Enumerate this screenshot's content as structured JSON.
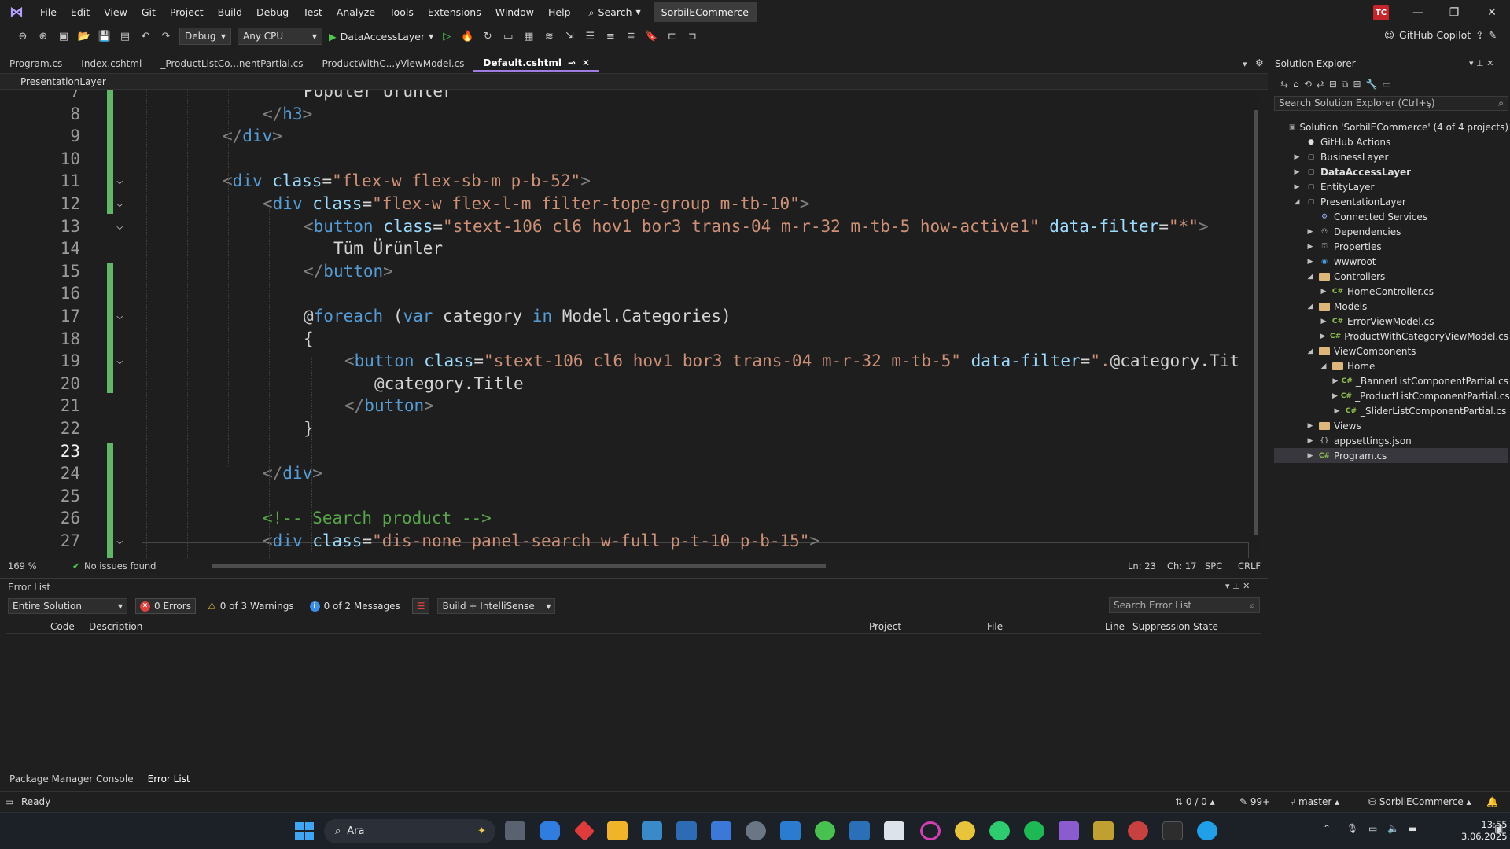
{
  "menu": {
    "items": [
      "File",
      "Edit",
      "View",
      "Git",
      "Project",
      "Build",
      "Debug",
      "Test",
      "Analyze",
      "Tools",
      "Extensions",
      "Window",
      "Help"
    ],
    "search_label": "Search",
    "solution_name": "SorbilECommerce",
    "user_initials": "TC"
  },
  "toolbar": {
    "config": "Debug",
    "platform": "Any CPU",
    "startup_project": "DataAccessLayer",
    "copilot_label": "GitHub Copilot"
  },
  "tabs": [
    {
      "label": "Program.cs",
      "active": false
    },
    {
      "label": "Index.cshtml",
      "active": false
    },
    {
      "label": "_ProductListCo...nentPartial.cs",
      "active": false
    },
    {
      "label": "ProductWithC...yViewModel.cs",
      "active": false
    },
    {
      "label": "Default.cshtml",
      "active": true
    }
  ],
  "navbar": {
    "project": "PresentationLayer"
  },
  "editor": {
    "current_line": "23",
    "lines": [
      {
        "n": "7",
        "parts": [
          [
            "tx",
            "Popüler Ürünler"
          ]
        ]
      },
      {
        "n": "8",
        "parts": [
          [
            "tag",
            "</"
          ],
          [
            "tn",
            "h3"
          ],
          [
            "tag",
            ">"
          ]
        ]
      },
      {
        "n": "9",
        "parts": [
          [
            "tag",
            "</"
          ],
          [
            "tn",
            "div"
          ],
          [
            "tag",
            ">"
          ]
        ]
      },
      {
        "n": "10",
        "parts": []
      },
      {
        "n": "11",
        "parts": [
          [
            "tag",
            "<"
          ],
          [
            "tn",
            "div "
          ],
          [
            "at",
            "class"
          ],
          [
            "tx",
            "="
          ],
          [
            "str",
            "\"flex-w flex-sb-m p-b-52\""
          ],
          [
            "tag",
            ">"
          ]
        ]
      },
      {
        "n": "12",
        "parts": [
          [
            "tag",
            "<"
          ],
          [
            "tn",
            "div "
          ],
          [
            "at",
            "class"
          ],
          [
            "tx",
            "="
          ],
          [
            "str",
            "\"flex-w flex-l-m filter-tope-group m-tb-10\""
          ],
          [
            "tag",
            ">"
          ]
        ]
      },
      {
        "n": "13",
        "parts": [
          [
            "tag",
            "<"
          ],
          [
            "tn",
            "button "
          ],
          [
            "at",
            "class"
          ],
          [
            "tx",
            "="
          ],
          [
            "str",
            "\"stext-106 cl6 hov1 bor3 trans-04 m-r-32 m-tb-5 how-active1\""
          ],
          [
            "tx",
            " "
          ],
          [
            "at",
            "data-filter"
          ],
          [
            "tx",
            "="
          ],
          [
            "str",
            "\"*\""
          ],
          [
            "tag",
            ">"
          ]
        ]
      },
      {
        "n": "14",
        "parts": [
          [
            "tx",
            "Tüm Ürünler"
          ]
        ]
      },
      {
        "n": "15",
        "parts": [
          [
            "tag",
            "</"
          ],
          [
            "tn",
            "button"
          ],
          [
            "tag",
            ">"
          ]
        ]
      },
      {
        "n": "16",
        "parts": []
      },
      {
        "n": "17",
        "parts": [
          [
            "rz",
            "@"
          ],
          [
            "kw",
            "foreach"
          ],
          [
            "tx",
            " ("
          ],
          [
            "kw",
            "var"
          ],
          [
            "tx",
            " category "
          ],
          [
            "kw",
            "in"
          ],
          [
            "tx",
            " Model.Categories)"
          ]
        ]
      },
      {
        "n": "18",
        "parts": [
          [
            "tx",
            "{"
          ]
        ]
      },
      {
        "n": "19",
        "parts": [
          [
            "tag",
            "<"
          ],
          [
            "tn",
            "button "
          ],
          [
            "at",
            "class"
          ],
          [
            "tx",
            "="
          ],
          [
            "str",
            "\"stext-106 cl6 hov1 bor3 trans-04 m-r-32 m-tb-5\""
          ],
          [
            "tx",
            " "
          ],
          [
            "at",
            "data-filter"
          ],
          [
            "tx",
            "="
          ],
          [
            "str",
            "\"."
          ],
          [
            "rz",
            "@"
          ],
          [
            "tx",
            "category.Tit"
          ]
        ]
      },
      {
        "n": "20",
        "parts": [
          [
            "rz",
            "@"
          ],
          [
            "tx",
            "category.Title"
          ]
        ]
      },
      {
        "n": "21",
        "parts": [
          [
            "tag",
            "</"
          ],
          [
            "tn",
            "button"
          ],
          [
            "tag",
            ">"
          ]
        ]
      },
      {
        "n": "22",
        "parts": [
          [
            "tx",
            "}"
          ]
        ]
      },
      {
        "n": "23",
        "parts": []
      },
      {
        "n": "24",
        "parts": [
          [
            "tag",
            "</"
          ],
          [
            "tn",
            "div"
          ],
          [
            "tag",
            ">"
          ]
        ]
      },
      {
        "n": "25",
        "parts": []
      },
      {
        "n": "26",
        "parts": [
          [
            "cm",
            "<!-- Search product -->"
          ]
        ]
      },
      {
        "n": "27",
        "parts": [
          [
            "tag",
            "<"
          ],
          [
            "tn",
            "div "
          ],
          [
            "at",
            "class"
          ],
          [
            "tx",
            "="
          ],
          [
            "str",
            "\"dis-none panel-search w-full p-t-10 p-b-15\""
          ],
          [
            "tag",
            ">"
          ]
        ]
      }
    ]
  },
  "editor_status": {
    "zoom": "169 %",
    "issues": "No issues found",
    "ln": "Ln: 23",
    "ch": "Ch: 17",
    "spc": "SPC",
    "eol": "CRLF"
  },
  "error_list": {
    "title": "Error List",
    "scope": "Entire Solution",
    "errors": "0 Errors",
    "warnings": "0 of 3 Warnings",
    "messages": "0 of 2 Messages",
    "source": "Build + IntelliSense",
    "search_placeholder": "Search Error List",
    "columns": [
      "Code",
      "Description",
      "Project",
      "File",
      "Line",
      "Suppression State"
    ]
  },
  "bottom_tabs": [
    "Package Manager Console",
    "Error List"
  ],
  "solution_explorer": {
    "title": "Solution Explorer",
    "search_placeholder": "Search Solution Explorer (Ctrl+ş)",
    "items": [
      {
        "label": "Solution 'SorbilECommerce' (4 of 4 projects)",
        "depth": 0,
        "arrow": "",
        "icon": "solution"
      },
      {
        "label": "GitHub Actions",
        "depth": 1,
        "arrow": "",
        "icon": "github"
      },
      {
        "label": "BusinessLayer",
        "depth": 1,
        "arrow": "▶",
        "icon": "project"
      },
      {
        "label": "DataAccessLayer",
        "depth": 1,
        "arrow": "▶",
        "icon": "project",
        "bold": true
      },
      {
        "label": "EntityLayer",
        "depth": 1,
        "arrow": "▶",
        "icon": "project"
      },
      {
        "label": "PresentationLayer",
        "depth": 1,
        "arrow": "◢",
        "icon": "project"
      },
      {
        "label": "Connected Services",
        "depth": 2,
        "arrow": "",
        "icon": "services"
      },
      {
        "label": "Dependencies",
        "depth": 2,
        "arrow": "▶",
        "icon": "deps"
      },
      {
        "label": "Properties",
        "depth": 2,
        "arrow": "▶",
        "icon": "props"
      },
      {
        "label": "wwwroot",
        "depth": 2,
        "arrow": "▶",
        "icon": "globe"
      },
      {
        "label": "Controllers",
        "depth": 2,
        "arrow": "◢",
        "icon": "folder"
      },
      {
        "label": "HomeController.cs",
        "depth": 3,
        "arrow": "▶",
        "icon": "cs"
      },
      {
        "label": "Models",
        "depth": 2,
        "arrow": "◢",
        "icon": "folder"
      },
      {
        "label": "ErrorViewModel.cs",
        "depth": 3,
        "arrow": "▶",
        "icon": "cs"
      },
      {
        "label": "ProductWithCategoryViewModel.cs",
        "depth": 3,
        "arrow": "▶",
        "icon": "cs"
      },
      {
        "label": "ViewComponents",
        "depth": 2,
        "arrow": "◢",
        "icon": "folder"
      },
      {
        "label": "Home",
        "depth": 3,
        "arrow": "◢",
        "icon": "folder"
      },
      {
        "label": "_BannerListComponentPartial.cs",
        "depth": 4,
        "arrow": "▶",
        "icon": "cs"
      },
      {
        "label": "_ProductListComponentPartial.cs",
        "depth": 4,
        "arrow": "▶",
        "icon": "cs"
      },
      {
        "label": "_SliderListComponentPartial.cs",
        "depth": 4,
        "arrow": "▶",
        "icon": "cs"
      },
      {
        "label": "Views",
        "depth": 2,
        "arrow": "▶",
        "icon": "folder"
      },
      {
        "label": "appsettings.json",
        "depth": 2,
        "arrow": "▶",
        "icon": "json"
      },
      {
        "label": "Program.cs",
        "depth": 2,
        "arrow": "▶",
        "icon": "cs",
        "selected": true
      }
    ]
  },
  "statusbar": {
    "ready": "Ready",
    "line_counter": "0 / 0",
    "pending": "99+",
    "branch": "master",
    "repo": "SorbilECommerce"
  },
  "taskbar": {
    "search_label": "Ara",
    "time": "13:55",
    "date": "3.06.2025"
  }
}
